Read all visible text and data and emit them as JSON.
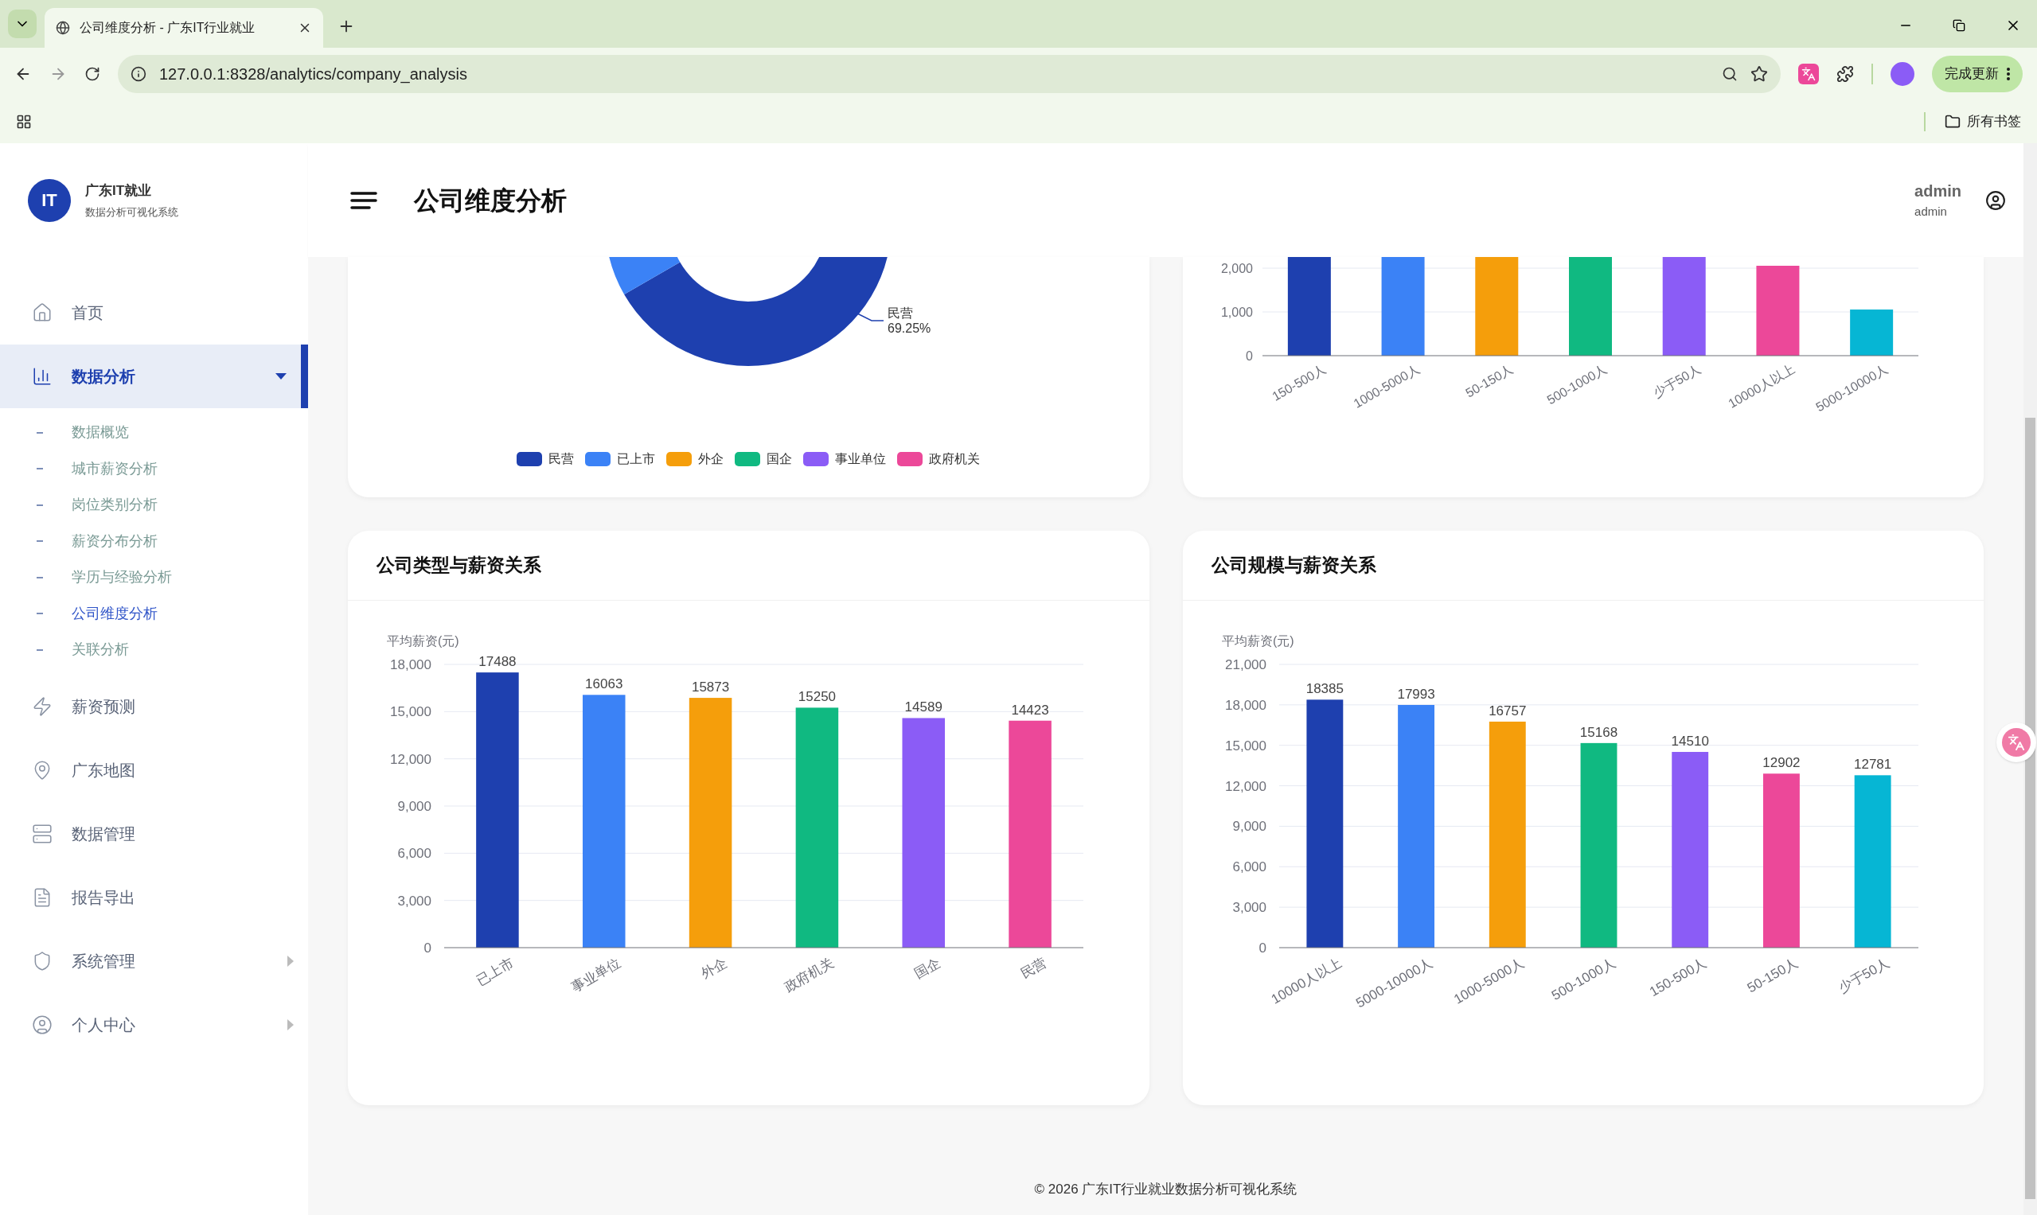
{
  "browser": {
    "tab_title": "公司维度分析 - 广东IT行业就业",
    "url": "127.0.0.1:8328/analytics/company_analysis",
    "update_button": "完成更新",
    "bookmarks_label": "所有书签"
  },
  "brand": {
    "logo_text": "IT",
    "name": "广东IT就业",
    "subtitle": "数据分析可视化系统"
  },
  "header": {
    "title": "公司维度分析",
    "user_name": "admin",
    "user_role": "admin"
  },
  "nav": [
    {
      "label": "首页",
      "selected": false
    },
    {
      "label": "数据分析",
      "selected": true,
      "expanded": true,
      "children": [
        {
          "label": "数据概览",
          "selected": false
        },
        {
          "label": "城市薪资分析",
          "selected": false
        },
        {
          "label": "岗位类别分析",
          "selected": false
        },
        {
          "label": "薪资分布分析",
          "selected": false
        },
        {
          "label": "学历与经验分析",
          "selected": false
        },
        {
          "label": "公司维度分析",
          "selected": true
        },
        {
          "label": "关联分析",
          "selected": false
        }
      ]
    },
    {
      "label": "薪资预测",
      "selected": false
    },
    {
      "label": "广东地图",
      "selected": false
    },
    {
      "label": "数据管理",
      "selected": false
    },
    {
      "label": "报告导出",
      "selected": false
    },
    {
      "label": "系统管理",
      "selected": false,
      "expanded": false
    },
    {
      "label": "个人中心",
      "selected": false,
      "expanded": false
    }
  ],
  "type_share_card": {
    "slice_label": {
      "name": "民营",
      "percent": "69.25%"
    },
    "legend": [
      {
        "label": "民营",
        "color": "#1e40af"
      },
      {
        "label": "已上市",
        "color": "#3b82f6"
      },
      {
        "label": "外企",
        "color": "#f59e0b"
      },
      {
        "label": "国企",
        "color": "#10b981"
      },
      {
        "label": "事业单位",
        "color": "#8b5cf6"
      },
      {
        "label": "政府机关",
        "color": "#ec4899"
      }
    ]
  },
  "size_count_card": {
    "yticks": [
      "2,000",
      "1,000",
      "0"
    ],
    "categories": [
      "150-500人",
      "1000-5000人",
      "50-150人",
      "500-1000人",
      "少于50人",
      "10000人以上",
      "5000-10000人"
    ]
  },
  "charts": [
    {
      "chart_data": {
        "type": "bar",
        "title": "公司类型与薪资关系",
        "ylabel": "平均薪资(元)",
        "categories": [
          "已上市",
          "事业单位",
          "外企",
          "政府机关",
          "国企",
          "民营"
        ],
        "values": [
          17488,
          16063,
          15873,
          15250,
          14589,
          14423
        ],
        "colors": [
          "#1e40af",
          "#3b82f6",
          "#f59e0b",
          "#10b981",
          "#8b5cf6",
          "#ec4899"
        ],
        "grid": true,
        "ylim": [
          0,
          18000
        ],
        "yticks": [
          {
            "value": 0,
            "label": "0"
          },
          {
            "value": 3000,
            "label": "3,000"
          },
          {
            "value": 6000,
            "label": "6,000"
          },
          {
            "value": 9000,
            "label": "9,000"
          },
          {
            "value": 12000,
            "label": "12,000"
          },
          {
            "value": 15000,
            "label": "15,000"
          },
          {
            "value": 18000,
            "label": "18,000"
          }
        ],
        "data_labels": true
      }
    },
    {
      "chart_data": {
        "type": "bar",
        "title": "公司规模与薪资关系",
        "ylabel": "平均薪资(元)",
        "categories": [
          "10000人以上",
          "5000-10000人",
          "1000-5000人",
          "500-1000人",
          "150-500人",
          "50-150人",
          "少于50人"
        ],
        "values": [
          18385,
          17993,
          16757,
          15168,
          14510,
          12902,
          12781
        ],
        "colors": [
          "#1e40af",
          "#3b82f6",
          "#f59e0b",
          "#10b981",
          "#8b5cf6",
          "#ec4899",
          "#06b6d4"
        ],
        "grid": true,
        "ylim": [
          0,
          21000
        ],
        "yticks": [
          {
            "value": 0,
            "label": "0"
          },
          {
            "value": 3000,
            "label": "3,000"
          },
          {
            "value": 6000,
            "label": "6,000"
          },
          {
            "value": 9000,
            "label": "9,000"
          },
          {
            "value": 12000,
            "label": "12,000"
          },
          {
            "value": 15000,
            "label": "15,000"
          },
          {
            "value": 18000,
            "label": "18,000"
          },
          {
            "value": 21000,
            "label": "21,000"
          }
        ],
        "data_labels": true
      }
    }
  ],
  "footer": "© 2026 广东IT行业就业数据分析可视化系统"
}
